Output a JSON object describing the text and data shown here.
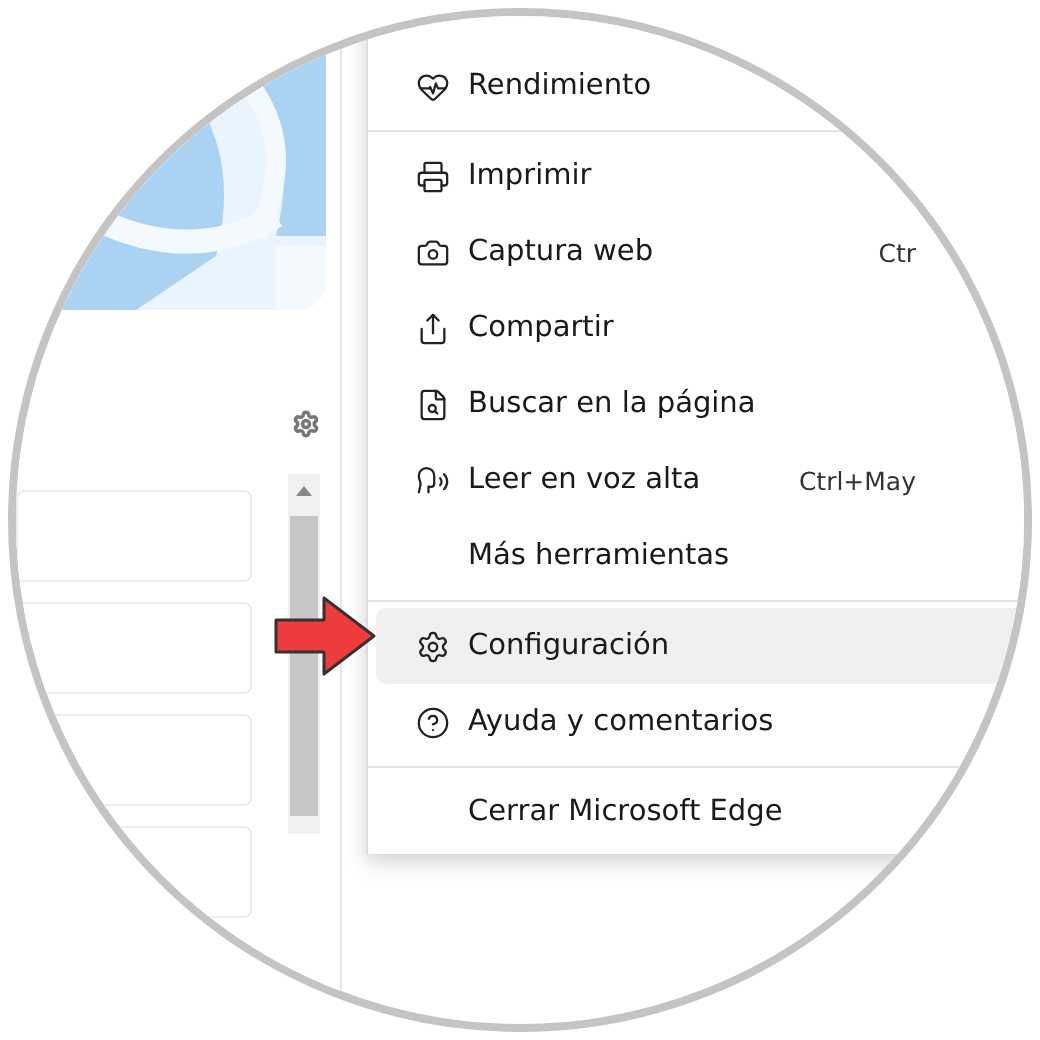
{
  "menu": {
    "items": [
      {
        "kind": "item",
        "label": "Rendimiento",
        "selected": false
      },
      {
        "kind": "divider"
      },
      {
        "kind": "item",
        "label": "Imprimir",
        "selected": false
      },
      {
        "kind": "item",
        "label": "Captura web",
        "shortcut": "Ctr",
        "selected": false
      },
      {
        "kind": "item",
        "label": "Compartir",
        "selected": false
      },
      {
        "kind": "item",
        "label": "Buscar en la página",
        "selected": false
      },
      {
        "kind": "item",
        "label": "Leer en voz alta",
        "shortcut": "Ctrl+May",
        "selected": false
      },
      {
        "kind": "item",
        "label": "Más herramientas",
        "selected": false
      },
      {
        "kind": "divider"
      },
      {
        "kind": "item",
        "label": "Configuración",
        "selected": true
      },
      {
        "kind": "item",
        "label": "Ayuda y comentarios",
        "selected": false
      },
      {
        "kind": "divider"
      },
      {
        "kind": "item",
        "label": "Cerrar Microsoft Edge",
        "selected": false
      }
    ]
  }
}
